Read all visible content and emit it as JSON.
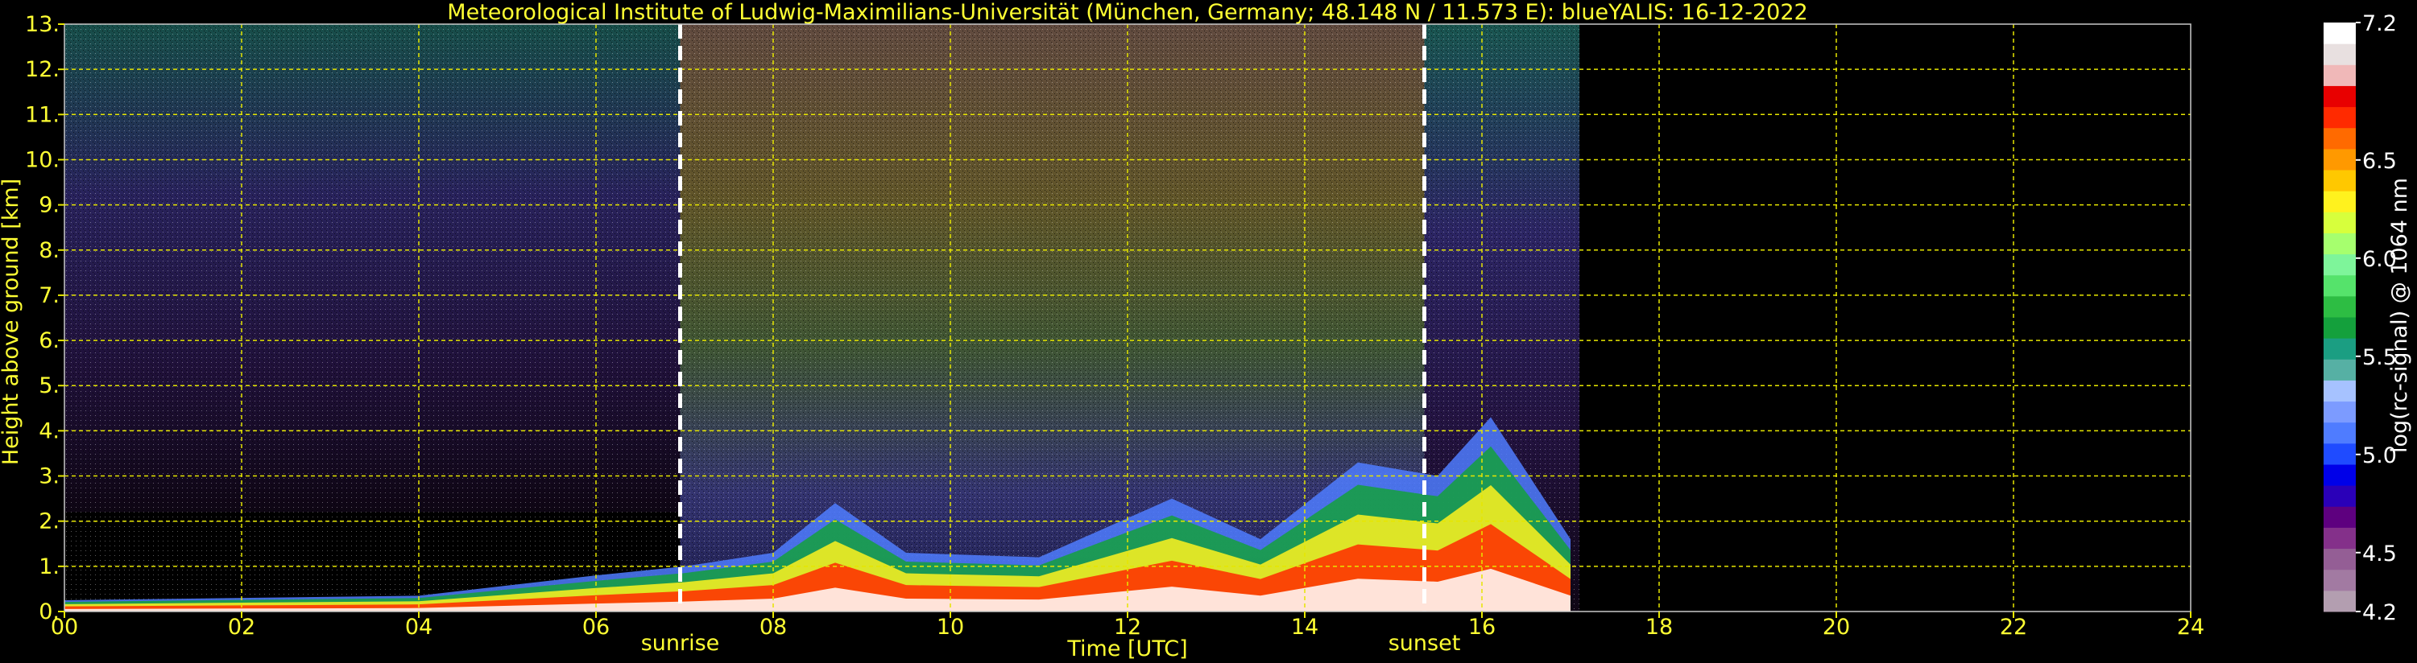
{
  "chart_data": {
    "type": "heatmap",
    "title": "Meteorological Institute of Ludwig-Maximilians-Universität (München, Germany; 48.148 N / 11.573 E):     blueYALIS: 16-12-2022",
    "xlabel": "Time [UTC]",
    "ylabel": "Height above ground [km]",
    "xlim": [
      0,
      24
    ],
    "ylim": [
      0,
      13
    ],
    "x_ticks": [
      "00",
      "02",
      "04",
      "06",
      "08",
      "10",
      "12",
      "14",
      "16",
      "18",
      "20",
      "22",
      "24"
    ],
    "y_ticks": [
      "0.",
      "1.",
      "2.",
      "3.",
      "4.",
      "5.",
      "6.",
      "7.",
      "8.",
      "9.",
      "10.",
      "11.",
      "12.",
      "13."
    ],
    "grid": true,
    "data_end_hour": 17.1,
    "events": [
      {
        "label": "sunrise",
        "hour": 6.95
      },
      {
        "label": "sunset",
        "hour": 15.35
      }
    ],
    "colorbar": {
      "label": "log(rc-signal) @ 1064 nm",
      "range": [
        4.2,
        7.2
      ],
      "ticks": [
        "4.2",
        "4.5",
        "5.0",
        "5.5",
        "6.0",
        "6.5",
        "7.2"
      ],
      "tick_values": [
        4.2,
        4.5,
        5.0,
        5.5,
        6.0,
        6.5,
        7.2
      ],
      "colors": [
        "#b39eb0",
        "#a27aa2",
        "#945e95",
        "#84308a",
        "#5e007f",
        "#2a00b8",
        "#0000e8",
        "#1f4bff",
        "#4f7cff",
        "#7c9bff",
        "#a6c2ff",
        "#56b0a4",
        "#1b9e82",
        "#14a03c",
        "#2dbd43",
        "#55e36b",
        "#7ef59a",
        "#a6ff6e",
        "#d7ff3c",
        "#fff21e",
        "#ffc800",
        "#ff9900",
        "#ff6a00",
        "#ff2a00",
        "#e80000",
        "#f0b8b8",
        "#e8e0e0",
        "#ffffff"
      ]
    },
    "boundary_layer_top_km": [
      {
        "hour": 0.0,
        "km": 0.25
      },
      {
        "hour": 2.0,
        "km": 0.3
      },
      {
        "hour": 4.0,
        "km": 0.35
      },
      {
        "hour": 6.0,
        "km": 0.8
      },
      {
        "hour": 7.0,
        "km": 1.0
      },
      {
        "hour": 8.0,
        "km": 1.3
      },
      {
        "hour": 8.7,
        "km": 2.4
      },
      {
        "hour": 9.5,
        "km": 1.3
      },
      {
        "hour": 11.0,
        "km": 1.2
      },
      {
        "hour": 12.5,
        "km": 2.5
      },
      {
        "hour": 13.5,
        "km": 1.6
      },
      {
        "hour": 14.6,
        "km": 3.3
      },
      {
        "hour": 15.5,
        "km": 3.0
      },
      {
        "hour": 16.1,
        "km": 4.3
      },
      {
        "hour": 17.0,
        "km": 1.6
      }
    ]
  }
}
